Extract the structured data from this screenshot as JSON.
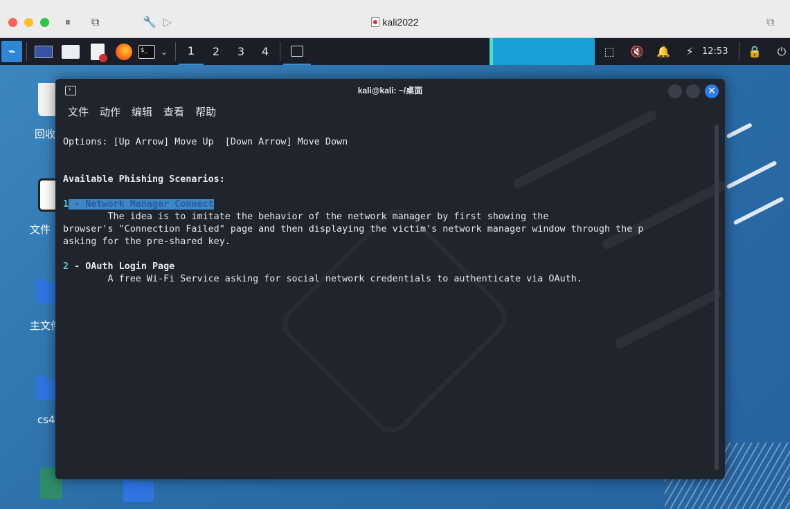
{
  "vm_window": {
    "title": "kali2022",
    "controls": {
      "pause": "⏸",
      "snapshot": "⧉",
      "settings": "🔧",
      "forward": "▷",
      "restore": "⧉"
    }
  },
  "panel": {
    "workspaces": [
      "1",
      "2",
      "3",
      "4"
    ],
    "clock": "12:53"
  },
  "desktop": {
    "icons": [
      {
        "label": "回收"
      },
      {
        "label": "文件"
      },
      {
        "label": "主文件夹"
      },
      {
        "label": "cs4"
      }
    ]
  },
  "terminal": {
    "title": "kali@kali: ~/桌面",
    "menu": [
      "文件",
      "动作",
      "编辑",
      "查看",
      "帮助"
    ],
    "lines": {
      "options": "Options: [Up Arrow] Move Up  [Down Arrow] Move Down",
      "header": "Available Phishing Scenarios:",
      "s1_num": "1",
      "s1_title": " - Network Manager Connect",
      "s1_desc1": "        The idea is to imitate the behavior of the network manager by first showing the",
      "s1_desc2": "browser's \"Connection Failed\" page and then displaying the victim's network manager window through the p",
      "s1_desc3": "asking for the pre-shared key.",
      "s2_num": "2",
      "s2_title": " - OAuth Login Page",
      "s2_desc": "        A free Wi-Fi Service asking for social network credentials to authenticate via OAuth."
    }
  },
  "colors": {
    "desktop_bg": "#2d6fa8",
    "panel_bg": "#1b1e27",
    "terminal_bg": "#20242d",
    "highlight": "#3e86c6",
    "accent": "#2e7ce8"
  }
}
